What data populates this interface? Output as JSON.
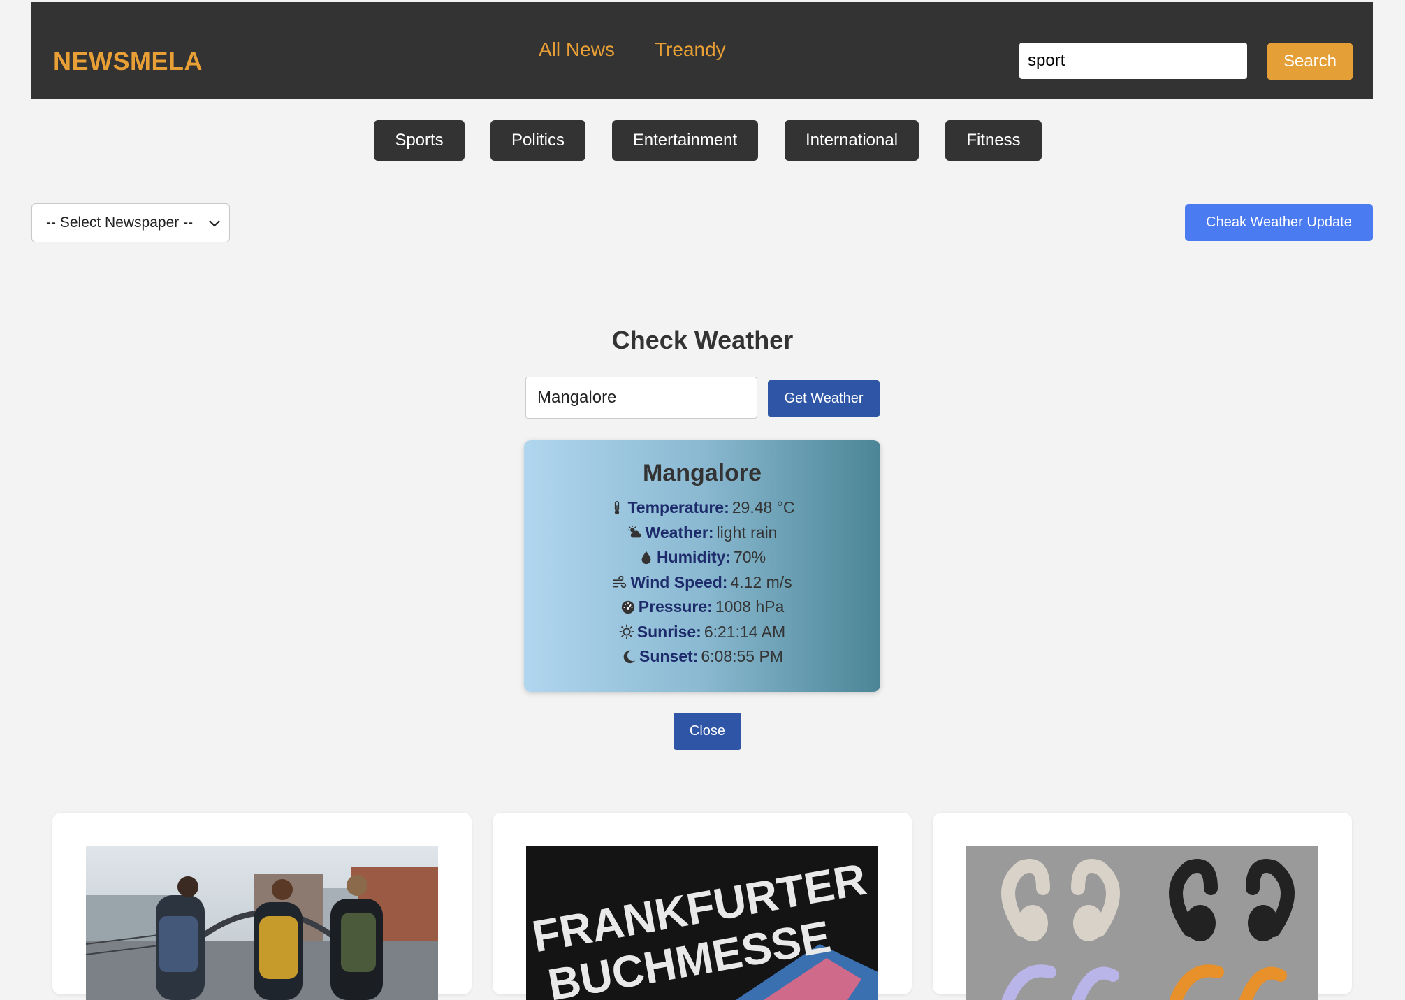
{
  "header": {
    "brand": "NEWSMELA",
    "nav": [
      "All News",
      "Treandy"
    ],
    "search_value": "sport",
    "search_button": "Search"
  },
  "categories": [
    "Sports",
    "Politics",
    "Entertainment",
    "International",
    "Fitness"
  ],
  "newspaper_select": {
    "selected": "-- Select Newspaper --"
  },
  "weather_update_button": "Cheak Weather Update",
  "weather": {
    "title": "Check Weather",
    "city_input_value": "Mangalore",
    "get_button": "Get Weather",
    "card": {
      "city": "Mangalore",
      "rows": [
        {
          "icon": "thermometer-icon",
          "label": "Temperature:",
          "value": "29.48 °C"
        },
        {
          "icon": "cloud-sun-icon",
          "label": "Weather:",
          "value": "light rain"
        },
        {
          "icon": "droplet-icon",
          "label": "Humidity:",
          "value": "70%"
        },
        {
          "icon": "wind-icon",
          "label": "Wind Speed:",
          "value": "4.12 m/s"
        },
        {
          "icon": "gauge-icon",
          "label": "Pressure:",
          "value": "1008 hPa"
        },
        {
          "icon": "sun-icon",
          "label": "Sunrise:",
          "value": "6:21:14 AM"
        },
        {
          "icon": "moon-icon",
          "label": "Sunset:",
          "value": "6:08:55 PM"
        }
      ]
    },
    "close_button": "Close"
  },
  "news_cards": [
    {
      "image": "people-walking-bridge-photo"
    },
    {
      "image": "frankfurter-buchmesse-photo",
      "image_text": [
        "FRANKFURTER",
        "BUCHMESSE"
      ]
    },
    {
      "image": "earbuds-product-photo"
    }
  ]
}
